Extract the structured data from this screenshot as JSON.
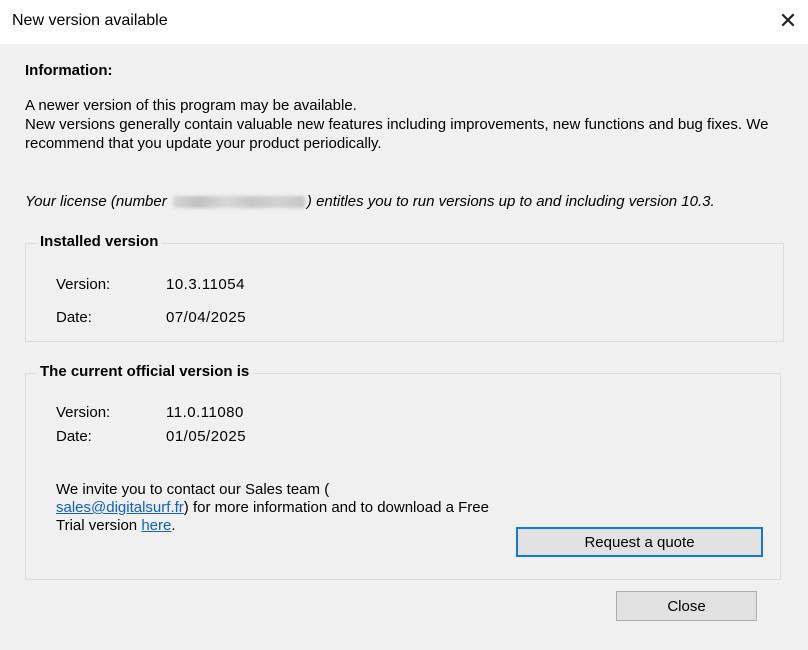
{
  "window": {
    "title": "New version available",
    "close_glyph": "✕"
  },
  "information": {
    "heading": "Information:",
    "line1": "A newer version of this program may be available.",
    "line2": "New versions generally contain valuable new features including improvements, new functions and bug fixes. We recommend that you update your product periodically."
  },
  "license": {
    "prefix": "Your license (number",
    "suffix": ") entitles you to run versions up to and including version 10.3."
  },
  "installed": {
    "title": "Installed version",
    "version_label": "Version:",
    "version_value": "10.3.11054",
    "date_label": "Date:",
    "date_value": "07/04/2025"
  },
  "official": {
    "title": "The current official version is",
    "version_label": "Version:",
    "version_value": "11.0.11080",
    "date_label": "Date:",
    "date_value": "01/05/2025",
    "invite_part1": "We invite you to contact our Sales team  (",
    "email_link": "sales@digitalsurf.fr",
    "invite_part2": ") for more information and to download a Free Trial version ",
    "here_link": "here",
    "invite_part3": "."
  },
  "buttons": {
    "request_quote": "Request a quote",
    "close": "Close"
  },
  "icons": {
    "close": "close-icon"
  }
}
